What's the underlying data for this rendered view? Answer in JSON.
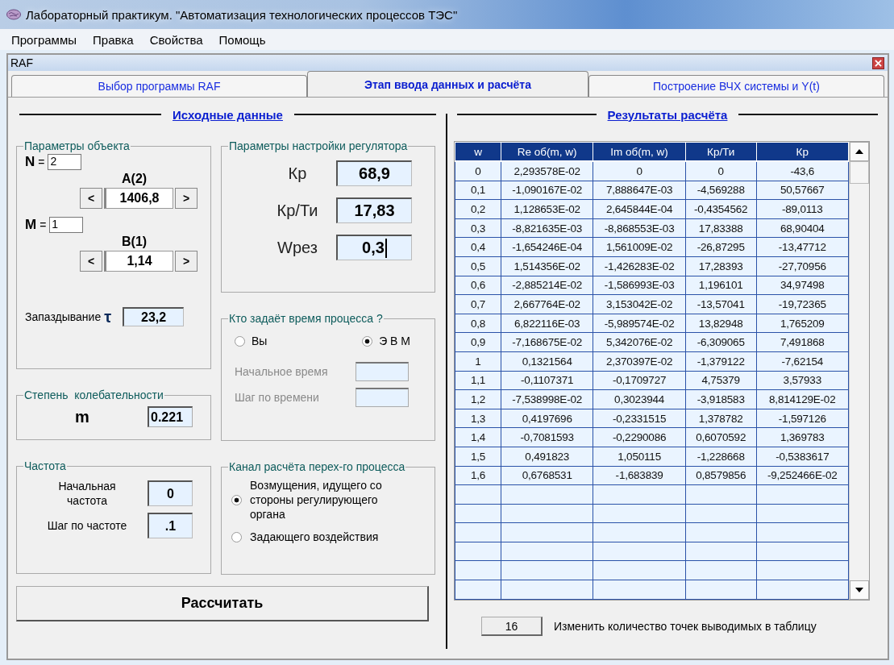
{
  "window": {
    "title": "Лабораторный практикум.  \"Автоматизация технологических процессов ТЭС\""
  },
  "menu": [
    "Программы",
    "Правка",
    "Свойства",
    "Помощь"
  ],
  "child_window": {
    "title": "RAF"
  },
  "tabs": [
    {
      "label": "Выбор программы RAF",
      "selected": false
    },
    {
      "label": "Этап ввода данных и расчёта",
      "selected": true
    },
    {
      "label": "Построение ВЧХ системы и Y(t)",
      "selected": false
    }
  ],
  "input_section": {
    "heading": "Исходные данные",
    "object_params": {
      "title": "Параметры объекта",
      "n": {
        "label": "N",
        "sign": "=",
        "value": "2"
      },
      "a": {
        "label": "A(2)",
        "prev": "<",
        "value": "1406,8",
        "next": ">"
      },
      "m": {
        "label": "M",
        "sign": "=",
        "value": "1"
      },
      "b": {
        "label": "B(1)",
        "prev": "<",
        "value": "1,14",
        "next": ">"
      },
      "delay": {
        "label": "Запаздывание",
        "symbol": "τ",
        "value": "23,2"
      }
    },
    "regulator_params": {
      "title": "Параметры настройки регулятора",
      "fields": [
        {
          "label": "Кр",
          "value": "68,9",
          "focused": false
        },
        {
          "label": "Кр/Ти",
          "value": "17,83",
          "focused": false
        },
        {
          "label": "Wрез",
          "value": "0,3",
          "focused": true
        }
      ]
    },
    "oscillation": {
      "title": "Степень  колебательности",
      "label": "m",
      "value": "0.221"
    },
    "process_time": {
      "title": "Кто задаёт время процесса ?",
      "options": [
        {
          "label": "Вы",
          "selected": false
        },
        {
          "label": "Э В М",
          "selected": true
        }
      ],
      "fields": [
        {
          "label": "Начальное время",
          "disabled": true
        },
        {
          "label": "Шаг по времени",
          "disabled": true
        }
      ]
    },
    "frequency": {
      "title": "Частота",
      "fields": [
        {
          "label": "Начальная частота",
          "value": "0"
        },
        {
          "label": "Шаг по частоте",
          "value": ".1"
        }
      ]
    },
    "channel": {
      "title": "Канал расчёта перех-го процесса",
      "options": [
        {
          "label": "Возмущения, идущего со стороны регулирующего органа",
          "selected": true
        },
        {
          "label": "Задающего воздействия",
          "selected": false
        }
      ]
    },
    "calculate_button": "Рассчитать"
  },
  "results_section": {
    "heading": "Результаты расчёта",
    "table": {
      "columns": [
        "w",
        "Re об(m, w)",
        "Im об(m, w)",
        "Кр/Ти",
        "Кр"
      ],
      "rows": [
        [
          "0",
          "2,293578E-02",
          "0",
          "0",
          "-43,6"
        ],
        [
          "0,1",
          "-1,090167E-02",
          "7,888647E-03",
          "-4,569288",
          "50,57667"
        ],
        [
          "0,2",
          "1,128653E-02",
          "2,645844E-04",
          "-0,4354562",
          "-89,0113"
        ],
        [
          "0,3",
          "-8,821635E-03",
          "-8,868553E-03",
          "17,83388",
          "68,90404"
        ],
        [
          "0,4",
          "-1,654246E-04",
          "1,561009E-02",
          "-26,87295",
          "-13,47712"
        ],
        [
          "0,5",
          "1,514356E-02",
          "-1,426283E-02",
          "17,28393",
          "-27,70956"
        ],
        [
          "0,6",
          "-2,885214E-02",
          "-1,586993E-03",
          "1,196101",
          "34,97498"
        ],
        [
          "0,7",
          "2,667764E-02",
          "3,153042E-02",
          "-13,57041",
          "-19,72365"
        ],
        [
          "0,8",
          "6,822116E-03",
          "-5,989574E-02",
          "13,82948",
          "1,765209"
        ],
        [
          "0,9",
          "-7,168675E-02",
          "5,342076E-02",
          "-6,309065",
          "7,491868"
        ],
        [
          "1",
          "0,1321564",
          "2,370397E-02",
          "-1,379122",
          "-7,62154"
        ],
        [
          "1,1",
          "-0,1107371",
          "-0,1709727",
          "4,75379",
          "3,57933"
        ],
        [
          "1,2",
          "-7,538998E-02",
          "0,3023944",
          "-3,918583",
          "8,814129E-02"
        ],
        [
          "1,3",
          "0,4197696",
          "-0,2331515",
          "1,378782",
          "-1,597126"
        ],
        [
          "1,4",
          "-0,7081593",
          "-0,2290086",
          "0,6070592",
          "1,369783"
        ],
        [
          "1,5",
          "0,491823",
          "1,050115",
          "-1,228668",
          "-0,5383617"
        ],
        [
          "1,6",
          "0,6768531",
          "-1,683839",
          "0,8579856",
          "-9,252466E-02"
        ]
      ]
    },
    "points_button": "16",
    "points_label": "Изменить количество точек выводимых в таблицу"
  }
}
